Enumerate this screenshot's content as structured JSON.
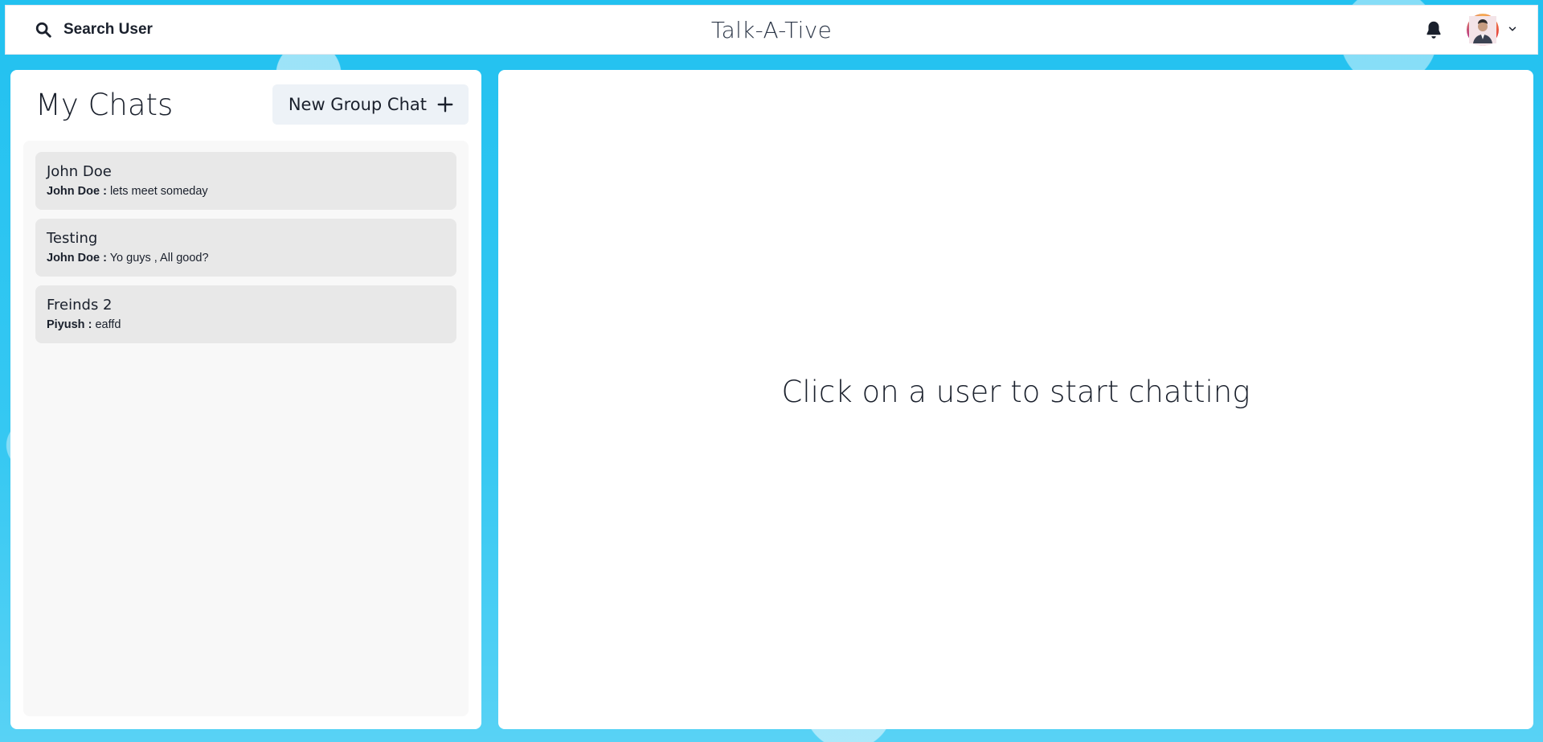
{
  "header": {
    "search_label": "Search User",
    "app_title": "Talk-A-Tive"
  },
  "sidebar": {
    "title": "My Chats",
    "new_group_label": "New Group Chat",
    "chats": [
      {
        "name": "John Doe",
        "sender": "John Doe :",
        "message": "lets meet someday"
      },
      {
        "name": "Testing",
        "sender": "John Doe :",
        "message": "Yo guys , All good?"
      },
      {
        "name": "Freinds 2",
        "sender": "Piyush :",
        "message": "eaffd"
      }
    ]
  },
  "main": {
    "empty_message": "Click on a user to start chatting"
  },
  "icons": {
    "search": "search-icon",
    "bell": "bell-icon",
    "avatar": "user-avatar",
    "chevron": "chevron-down-icon",
    "plus": "plus-icon"
  },
  "colors": {
    "background": "#22c1f0",
    "panel": "#ffffff",
    "chat_item": "#e8e8e8",
    "button": "#edf2f7"
  }
}
